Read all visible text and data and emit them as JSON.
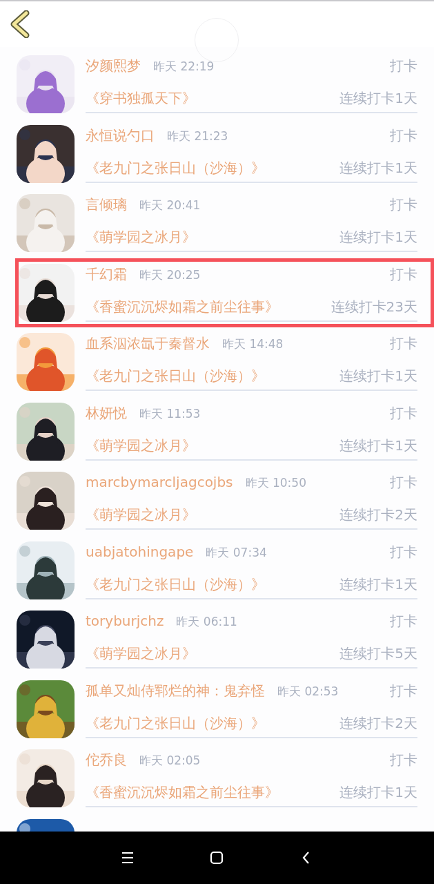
{
  "header": {
    "back": true
  },
  "rows": [
    {
      "name": "汐颜熙梦",
      "time": "昨天 22:19",
      "action": "打卡",
      "book": "《穿书独孤天下》",
      "streak": "连续打卡1天",
      "highlighted": false
    },
    {
      "name": "永恒说勺口",
      "time": "昨天 21:23",
      "action": "打卡",
      "book": "《老九门之张日山（沙海）》",
      "streak": "连续打卡1天",
      "highlighted": false
    },
    {
      "name": "言倾璃",
      "time": "昨天 20:41",
      "action": "打卡",
      "book": "《萌学园之冰月》",
      "streak": "连续打卡1天",
      "highlighted": false
    },
    {
      "name": "千幻霜",
      "time": "昨天 20:25",
      "action": "打卡",
      "book": "《香蜜沉沉烬如霜之前尘往事》",
      "streak": "连续打卡23天",
      "highlighted": true
    },
    {
      "name": "血系泅浓氙于秦督水",
      "time": "昨天 14:48",
      "action": "打卡",
      "book": "《老九门之张日山（沙海）》",
      "streak": "连续打卡1天",
      "highlighted": false
    },
    {
      "name": "林妍悦",
      "time": "昨天 11:53",
      "action": "打卡",
      "book": "《萌学园之冰月》",
      "streak": "连续打卡1天",
      "highlighted": false
    },
    {
      "name": "marcbymarcljagcojbs",
      "time": "昨天 10:50",
      "action": "打卡",
      "book": "《萌学园之冰月》",
      "streak": "连续打卡2天",
      "highlighted": false
    },
    {
      "name": "uabjatohingape",
      "time": "昨天 07:34",
      "action": "打卡",
      "book": "《老九门之张日山（沙海）》",
      "streak": "连续打卡1天",
      "highlighted": false
    },
    {
      "name": "toryburjchz",
      "time": "昨天 06:11",
      "action": "打卡",
      "book": "《萌学园之冰月》",
      "streak": "连续打卡5天",
      "highlighted": false
    },
    {
      "name": "孤单又灿侍郓烂的神：鬼弃怪",
      "time": "昨天 02:53",
      "action": "打卡",
      "book": "《老九门之张日山（沙海）》",
      "streak": "连续打卡2天",
      "highlighted": false
    },
    {
      "name": "佗乔良",
      "time": "昨天 02:05",
      "action": "打卡",
      "book": "《香蜜沉沉烬如霜之前尘往事》",
      "streak": "连续打卡1天",
      "highlighted": false
    }
  ]
}
